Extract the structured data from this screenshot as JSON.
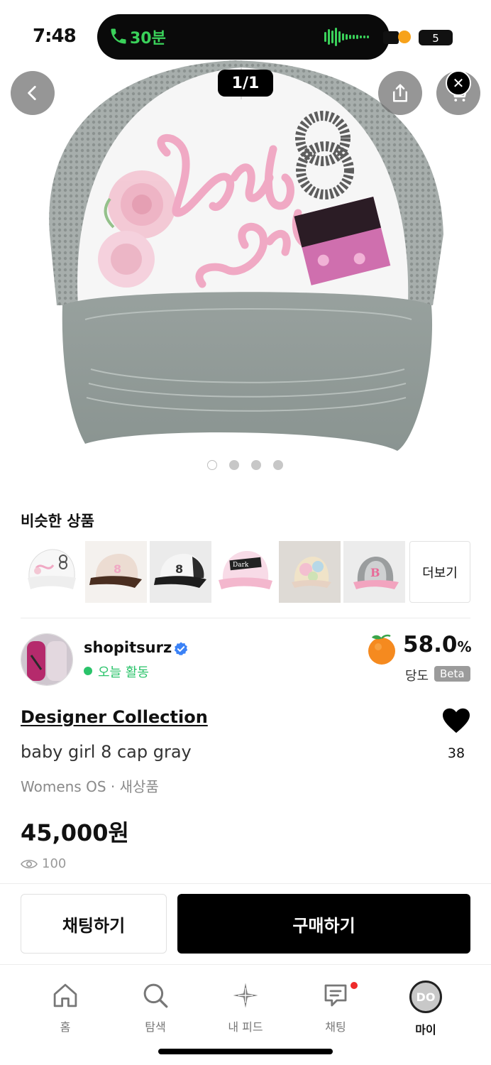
{
  "status_bar": {
    "time": "7:48",
    "call_duration": "30분",
    "battery": "5"
  },
  "hero": {
    "image_counter": "1/1",
    "carousel_dots": 4,
    "active_dot": 0
  },
  "similar": {
    "title": "비슷한 상품",
    "more_label": "더보기",
    "items": [
      {
        "desc": "white trucker cap with pink baby girl 8 print"
      },
      {
        "desc": "brown cap with pink 8"
      },
      {
        "desc": "black and white mesh cap"
      },
      {
        "desc": "pink Dark cap"
      },
      {
        "desc": "tie-dye pastel cap"
      },
      {
        "desc": "pink and gray B cap"
      }
    ]
  },
  "seller": {
    "name": "shopitsurz",
    "activity": "오늘 활동",
    "score": "58.0",
    "score_unit": "%",
    "score_label": "당도",
    "beta_label": "Beta"
  },
  "product": {
    "brand": "Designer Collection",
    "name": "baby girl 8 cap gray",
    "meta": "Womens OS · 새상품",
    "price": "45,000원",
    "views": "100",
    "likes": "38"
  },
  "actions": {
    "chat_label": "채팅하기",
    "buy_label": "구매하기"
  },
  "tabbar": {
    "items": [
      {
        "label": "홈",
        "icon": "home-icon"
      },
      {
        "label": "탐색",
        "icon": "search-icon"
      },
      {
        "label": "내 피드",
        "icon": "sparkle-icon"
      },
      {
        "label": "채팅",
        "icon": "chat-bubble-icon"
      },
      {
        "label": "마이",
        "icon": "avatar-icon"
      }
    ],
    "my_avatar_text": "DO",
    "active_index": 4
  },
  "colors": {
    "accent_green": "#2ac36a",
    "verified_blue": "#3b82f6",
    "chat_dot_red": "#ee2a2a",
    "cap_gray": "#9da6a3",
    "cap_pink": "#f0a9c4"
  }
}
